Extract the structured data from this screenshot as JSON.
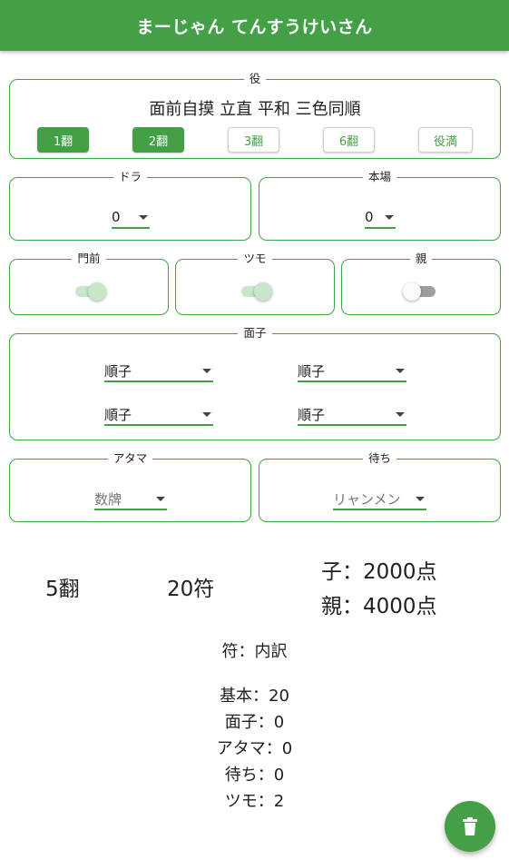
{
  "app": {
    "title": "まーじゃん てんすうけいさん"
  },
  "yaku": {
    "legend": "役",
    "selected_text": "面前自摸 立直 平和 三色同順",
    "buttons": [
      "1翻",
      "2翻",
      "3翻",
      "6翻",
      "役満"
    ]
  },
  "dora": {
    "legend": "ドラ",
    "value": "0"
  },
  "honba": {
    "legend": "本場",
    "value": "0"
  },
  "menzen": {
    "legend": "門前",
    "on": true
  },
  "tsumo": {
    "legend": "ツモ",
    "on": true
  },
  "oya": {
    "legend": "親",
    "on": false
  },
  "mentsu": {
    "legend": "面子",
    "values": [
      "順子",
      "順子",
      "順子",
      "順子"
    ]
  },
  "atama": {
    "legend": "アタマ",
    "value": "数牌"
  },
  "machi": {
    "legend": "待ち",
    "value": "リャンメン"
  },
  "result": {
    "han": "5翻",
    "fu": "20符",
    "child": "子：2000点",
    "parent": "親：4000点"
  },
  "fu_breakdown": {
    "title": "符：内訳",
    "lines": [
      "基本：20",
      "面子：0",
      "アタマ：0",
      "待ち：0",
      "ツモ：2"
    ]
  },
  "fab": {
    "icon": "trash-icon"
  },
  "colors": {
    "accent": "#43a047",
    "toggle_on": "#c8e6c9",
    "toggle_off": "#9e9e9e"
  }
}
